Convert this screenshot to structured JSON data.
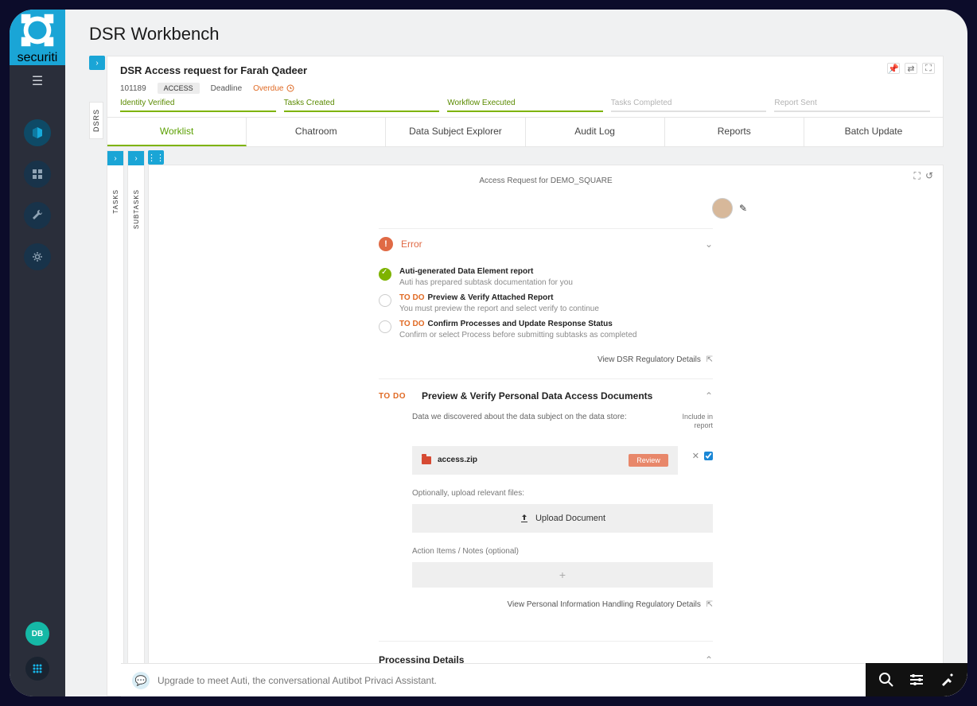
{
  "brand": "securiti",
  "page_title": "DSR Workbench",
  "rails": {
    "dsrs": "DSRS",
    "tasks": "TASKS",
    "subtasks": "SUBTASKS"
  },
  "request": {
    "title": "DSR Access request for Farah Qadeer",
    "id": "101189",
    "type_badge": "ACCESS",
    "deadline_label": "Deadline",
    "deadline_status": "Overdue"
  },
  "phases": [
    {
      "label": "Identity Verified",
      "state": "done"
    },
    {
      "label": "Tasks Created",
      "state": "done"
    },
    {
      "label": "Workflow Executed",
      "state": "done"
    },
    {
      "label": "Tasks Completed",
      "state": "pending"
    },
    {
      "label": "Report Sent",
      "state": "pending"
    }
  ],
  "tabs": [
    "Worklist",
    "Chatroom",
    "Data Subject Explorer",
    "Audit Log",
    "Reports",
    "Batch Update"
  ],
  "active_tab": 0,
  "body_title": "Access Request for DEMO_SQUARE",
  "error_panel": {
    "label": "Error"
  },
  "steps": [
    {
      "done": true,
      "todo": false,
      "title": "Auti-generated Data Element report",
      "sub": "Auti has prepared subtask documentation for you"
    },
    {
      "done": false,
      "todo": true,
      "title": "Preview & Verify Attached Report",
      "sub": "You must preview the report and select verify to continue"
    },
    {
      "done": false,
      "todo": true,
      "title": "Confirm Processes and Update Response Status",
      "sub": "Confirm or select Process before submitting subtasks as completed"
    }
  ],
  "todo_label": "TO DO",
  "link1": "View DSR Regulatory Details",
  "preview": {
    "title": "Preview & Verify Personal Data Access Documents",
    "discovered_label": "Data we discovered about the data subject on the data store:",
    "include_label_1": "Include in",
    "include_label_2": "report",
    "file_name": "access.zip",
    "review_btn": "Review",
    "upload_hint": "Optionally, upload relevant files:",
    "upload_btn": "Upload Document",
    "notes_label": "Action Items / Notes (optional)",
    "link2": "View Personal Information Handling Regulatory Details"
  },
  "processing_title": "Processing Details",
  "avatar_initials": "DB",
  "chat_hint": "Upgrade to meet Auti, the conversational Autibot Privaci Assistant."
}
